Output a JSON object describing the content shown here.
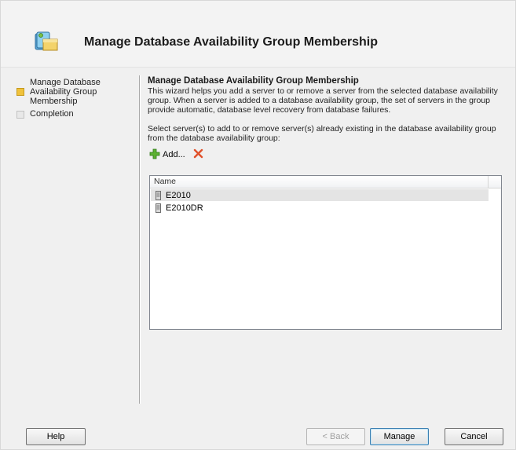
{
  "header": {
    "title": "Manage Database Availability Group Membership",
    "icon": "wizard-database-icon"
  },
  "steps": [
    {
      "label": "Manage Database Availability Group Membership",
      "state": "active",
      "color": "#f0c23c"
    },
    {
      "label": "Completion",
      "state": "inactive"
    }
  ],
  "content": {
    "title": "Manage Database Availability Group Membership",
    "description": "This wizard helps you add a server to or remove a server from the selected database availability group. When a server is added to a database availability group, the set of servers in the group provide automatic, database level recovery from database failures.",
    "instruction": "Select server(s) to add to or remove server(s) already existing in the database availability group from the database availability group:"
  },
  "toolbar": {
    "add_label": "Add...",
    "add_icon": "green-plus-icon",
    "remove_icon": "red-x-icon"
  },
  "list": {
    "column_header": "Name",
    "rows": [
      {
        "name": "E2010",
        "selected": true
      },
      {
        "name": "E2010DR",
        "selected": false
      }
    ]
  },
  "footer": {
    "help": "Help",
    "back": "< Back",
    "manage": "Manage",
    "cancel": "Cancel"
  }
}
